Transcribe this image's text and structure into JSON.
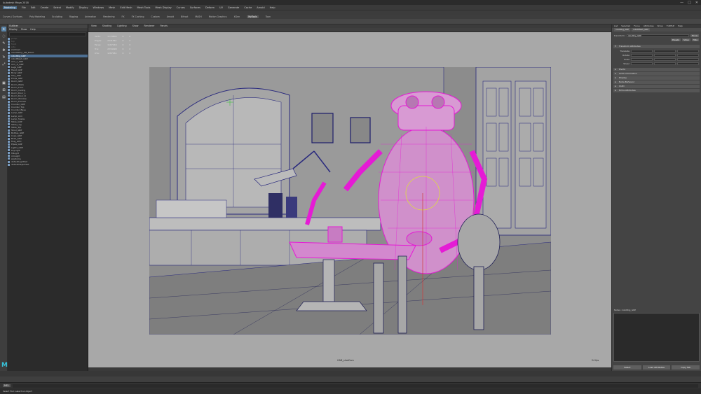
{
  "app": {
    "title": "Autodesk Maya 2018",
    "window_buttons": [
      "—",
      "□",
      "✕"
    ]
  },
  "menubar": {
    "items": [
      "File",
      "Edit",
      "Create",
      "Select",
      "Modify",
      "Display",
      "Windows",
      "Mesh",
      "Edit Mesh",
      "Mesh Tools",
      "Mesh Display",
      "Curves",
      "Surfaces",
      "Deform",
      "UV",
      "Generate",
      "Cache",
      "Arnold",
      "Help"
    ],
    "active_item": "Modeling"
  },
  "shelf": {
    "tabs": [
      "Curves / Surfaces",
      "Poly Modeling",
      "Sculpting",
      "Rigging",
      "Animation",
      "Rendering",
      "FX",
      "FX Caching",
      "Custom",
      "Arnold",
      "Bifrost",
      "MASH",
      "Motion Graphics",
      "XGen",
      "MyTools",
      "Toon"
    ],
    "active_tab": "MyTools"
  },
  "toolbox": {
    "tools": [
      "arrow-icon",
      "lasso-icon",
      "paint-icon",
      "move-icon",
      "rotate-icon",
      "scale-icon"
    ]
  },
  "outliner": {
    "title": "Outliner",
    "menu": [
      "Display",
      "Show",
      "Help"
    ],
    "rows": [
      {
        "label": "persp",
        "state": "dim"
      },
      {
        "label": "top",
        "state": "dim"
      },
      {
        "label": "front",
        "state": "dim"
      },
      {
        "label": "side",
        "state": "dim"
      },
      {
        "label": "shotCam",
        "state": "normal"
      },
      {
        "label": "mainSetup_SM_Robot",
        "state": "normal"
      },
      {
        "label": "robotRig_GRP",
        "state": "sel"
      },
      {
        "label": "robotMesh_GRP",
        "state": "normal"
      },
      {
        "label": "Arm_L_GRP",
        "state": "normal"
      },
      {
        "label": "Arm_R_GRP",
        "state": "normal"
      },
      {
        "label": "Legs_GRP",
        "state": "normal"
      },
      {
        "label": "Head_GRP",
        "state": "normal"
      },
      {
        "label": "Body_GRP",
        "state": "normal"
      },
      {
        "label": "Tray_GRP",
        "state": "normal"
      },
      {
        "label": "Props_GRP",
        "state": "normal"
      },
      {
        "label": "Room_GRP",
        "state": "normal"
      },
      {
        "label": "Room_Walls",
        "state": "normal"
      },
      {
        "label": "Room_Floor",
        "state": "normal"
      },
      {
        "label": "Room_Ceiling",
        "state": "normal"
      },
      {
        "label": "Room_Door_L",
        "state": "normal"
      },
      {
        "label": "Room_Door_R",
        "state": "normal"
      },
      {
        "label": "Room_Window",
        "state": "normal"
      },
      {
        "label": "Room_Frames",
        "state": "normal"
      },
      {
        "label": "Counter_GRP",
        "state": "normal"
      },
      {
        "label": "Counter_Top",
        "state": "normal"
      },
      {
        "label": "Counter_Base",
        "state": "normal"
      },
      {
        "label": "Lamp_GRP",
        "state": "normal"
      },
      {
        "label": "Lamp_Arm",
        "state": "normal"
      },
      {
        "label": "Lamp_Shade",
        "state": "normal"
      },
      {
        "label": "Table_GRP",
        "state": "normal"
      },
      {
        "label": "Table_Leg",
        "state": "normal"
      },
      {
        "label": "Table_Top",
        "state": "normal"
      },
      {
        "label": "Stool_GRP",
        "state": "normal"
      },
      {
        "label": "Bottles_GRP",
        "state": "normal"
      },
      {
        "label": "Cups_GRP",
        "state": "normal"
      },
      {
        "label": "Bowl_GEO",
        "state": "normal"
      },
      {
        "label": "Mug_GEO",
        "state": "normal"
      },
      {
        "label": "Pipes_GRP",
        "state": "normal"
      },
      {
        "label": "Lights_GRP",
        "state": "normal"
      },
      {
        "label": "keyLight",
        "state": "normal"
      },
      {
        "label": "fillLight",
        "state": "normal"
      },
      {
        "label": "rimLight",
        "state": "normal"
      },
      {
        "label": "skyDome",
        "state": "normal"
      },
      {
        "label": "defaultLightSet",
        "state": "normal"
      },
      {
        "label": "defaultObjectSet",
        "state": "normal"
      }
    ]
  },
  "viewport": {
    "panel_menu": [
      "View",
      "Shading",
      "Lighting",
      "Show",
      "Renderer",
      "Panels"
    ],
    "hud": [
      [
        "Verts:",
        "1174800",
        "0",
        "0"
      ],
      [
        "Edges:",
        "2341561",
        "0",
        "0"
      ],
      [
        "Faces:",
        "1167249",
        "0",
        "0"
      ],
      [
        "Tris:",
        "2334498",
        "0",
        "0"
      ],
      [
        "UVs:",
        "1287461",
        "0",
        "0"
      ]
    ],
    "camera_name": "CAM_shotCam",
    "fps_label": "24 fps"
  },
  "attribute_editor": {
    "tabs": [
      "List",
      "Selected",
      "Focus",
      "Attributes",
      "Show",
      "TURTLE",
      "Help"
    ],
    "node_tabs": [
      "robotRig_GRP",
      "robotMesh_GRP"
    ],
    "transform_label": "transform:",
    "transform_value": "robotRig_GRP",
    "focus_btn": "Focus",
    "presets_btn": "Presets",
    "show_btn": "Show",
    "hide_btn": "Hide",
    "section_header": "Transform Attributes",
    "fields": [
      {
        "label": "Translate",
        "value": ""
      },
      {
        "label": "Rotate",
        "value": ""
      },
      {
        "label": "Scale",
        "value": ""
      },
      {
        "label": "Shear",
        "value": ""
      }
    ],
    "sections": [
      "Pivots",
      "Limit Information",
      "Display",
      "Node Behavior",
      "UUID",
      "Extra Attributes"
    ],
    "notes_label": "Notes: robotRig_GRP",
    "buttons": [
      "Select",
      "Load Attributes",
      "Copy Tab"
    ]
  },
  "command_line": {
    "mel_label": "MEL"
  },
  "help_line": {
    "text": "Select Tool: select an object"
  },
  "logo": {
    "letter": "M"
  },
  "colors": {
    "selection": "#e51bd5",
    "wire": "#2a2a7e",
    "accent": "#5b86aa"
  }
}
